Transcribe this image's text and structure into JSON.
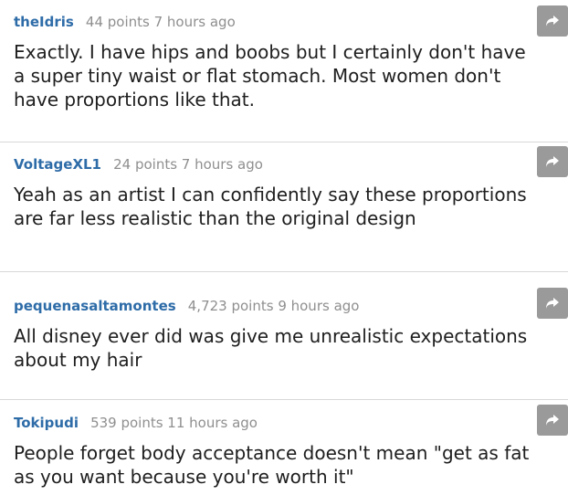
{
  "colors": {
    "username": "#2e6ca8",
    "meta": "#8f8f8f",
    "text": "#1e1e1e",
    "button": "#9a9a9a",
    "divider": "#d8d8d8"
  },
  "comments": [
    {
      "username": "theIdris",
      "meta": "44 points 7 hours ago",
      "text": "Exactly. I have hips and boobs but I certainly don't have a super tiny waist or flat stomach. Most women don't have proportions like that.",
      "share_icon": "share-arrow-icon"
    },
    {
      "username": "VoltageXL1",
      "meta": "24 points 7 hours ago",
      "text": "Yeah as an artist I can confidently say these proportions are far less realistic than the original design",
      "share_icon": "share-arrow-icon"
    },
    {
      "username": "pequenasaltamontes",
      "meta": "4,723 points 9 hours ago",
      "text": "All disney ever did was give me unrealistic expectations about my hair",
      "share_icon": "share-arrow-icon"
    },
    {
      "username": "Tokipudi",
      "meta": "539 points 11 hours ago",
      "text": "People forget body acceptance doesn't mean \"get as fat as you want because you're worth it\"",
      "share_icon": "share-arrow-icon"
    }
  ]
}
